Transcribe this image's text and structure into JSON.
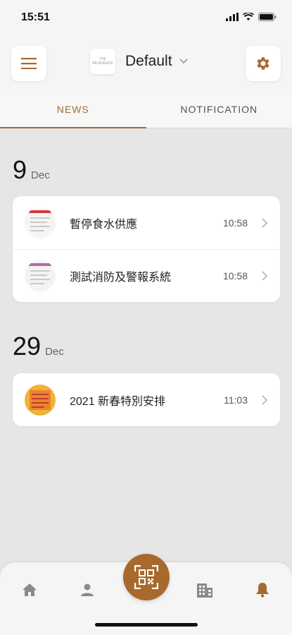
{
  "status": {
    "time": "15:51"
  },
  "header": {
    "title": "Default",
    "logo_text": "THE RESIDENCE"
  },
  "tabs": [
    {
      "label": "NEWS",
      "active": true
    },
    {
      "label": "NOTIFICATION",
      "active": false
    }
  ],
  "groups": [
    {
      "day": "9",
      "month": "Dec",
      "items": [
        {
          "title": "暫停食水供應",
          "time": "10:58"
        },
        {
          "title": "測試消防及警報系統",
          "time": "10:58"
        }
      ]
    },
    {
      "day": "29",
      "month": "Dec",
      "items": [
        {
          "title": "2021 新春特別安排",
          "time": "11:03"
        }
      ]
    }
  ],
  "bottom_nav": [
    {
      "name": "home",
      "icon": "home-icon"
    },
    {
      "name": "profile",
      "icon": "person-icon"
    },
    {
      "name": "qr",
      "icon": "qr-code-icon"
    },
    {
      "name": "building",
      "icon": "building-icon"
    },
    {
      "name": "notifications",
      "icon": "bell-icon"
    }
  ],
  "colors": {
    "accent": "#a8692c",
    "background": "#e6e6e6"
  }
}
